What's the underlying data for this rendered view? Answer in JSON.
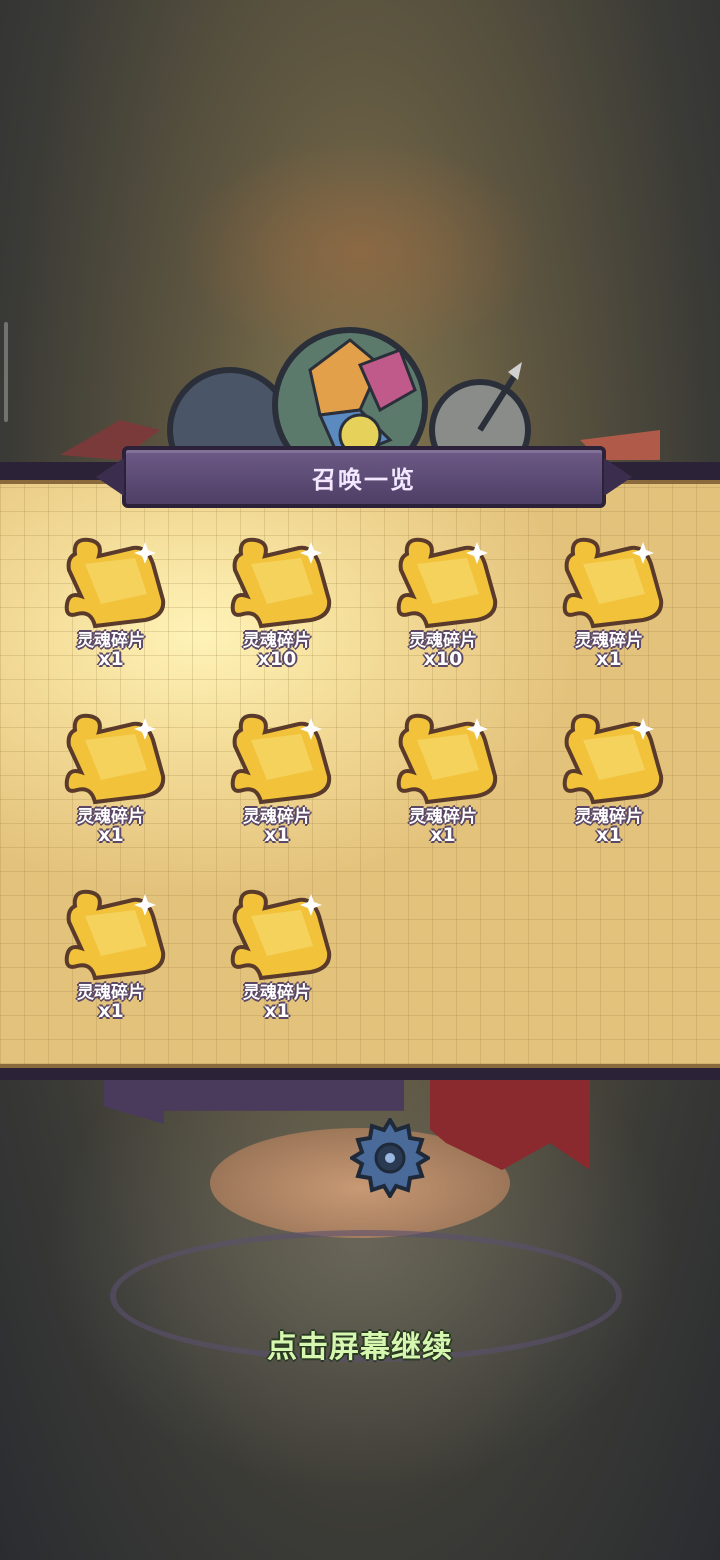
{
  "title": "召唤一览",
  "items": [
    {
      "name": "灵魂碎片",
      "count": "x1"
    },
    {
      "name": "灵魂碎片",
      "count": "x10"
    },
    {
      "name": "灵魂碎片",
      "count": "x10"
    },
    {
      "name": "灵魂碎片",
      "count": "x1"
    },
    {
      "name": "灵魂碎片",
      "count": "x1"
    },
    {
      "name": "灵魂碎片",
      "count": "x1"
    },
    {
      "name": "灵魂碎片",
      "count": "x1"
    },
    {
      "name": "灵魂碎片",
      "count": "x1"
    },
    {
      "name": "灵魂碎片",
      "count": "x1"
    },
    {
      "name": "灵魂碎片",
      "count": "x1"
    }
  ],
  "continue_hint": "点击屏幕继续",
  "colors": {
    "banner": "#5e4c78",
    "piece": "#f2c23a",
    "hint": "#d6f7b0"
  },
  "icons": {
    "item": "puzzle-piece-icon",
    "gear": "gear-icon"
  }
}
